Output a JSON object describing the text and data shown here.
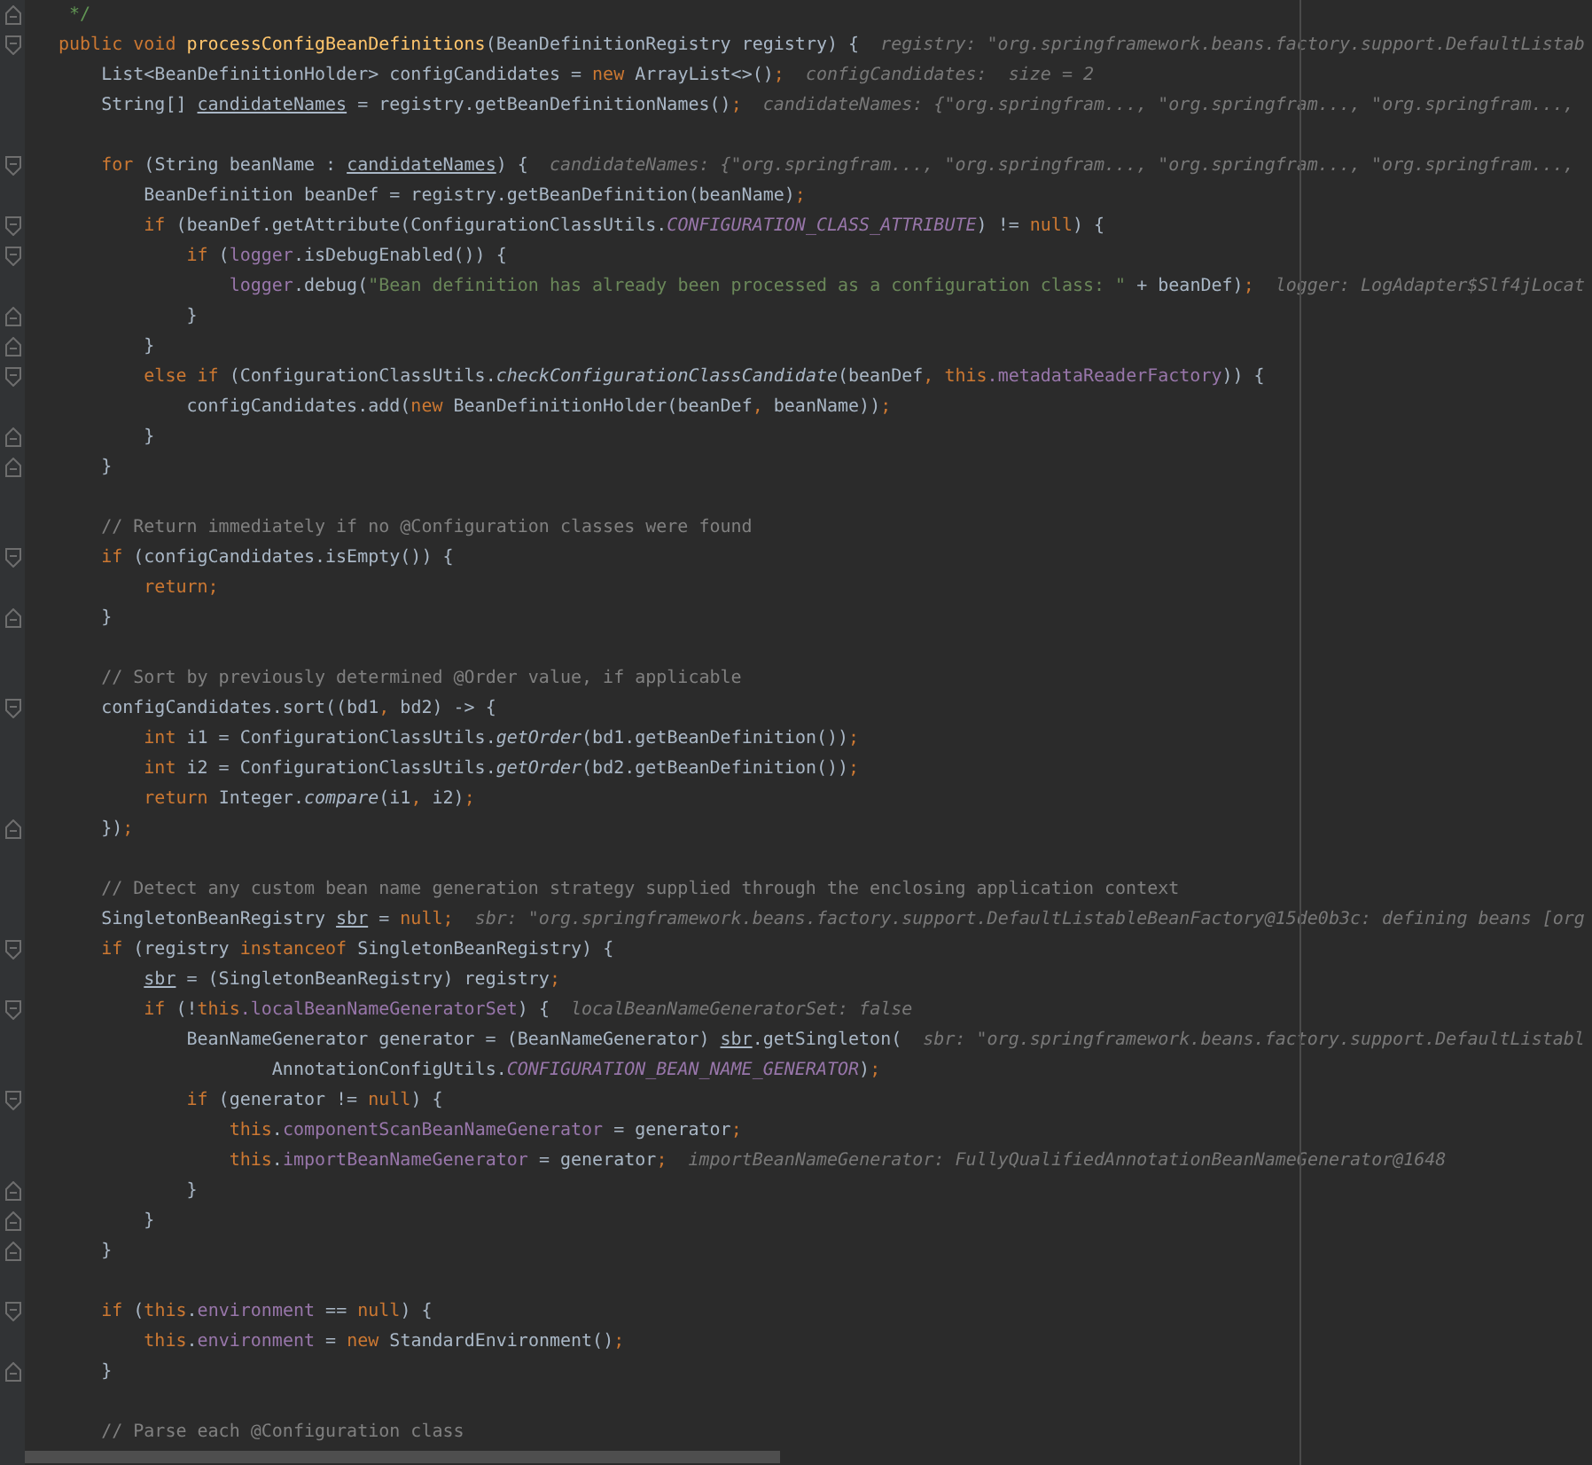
{
  "editor": {
    "lines": [
      {
        "kind": "doc-end",
        "fold_end": true,
        "tokens": [
          {
            "kind": "doc",
            "text": "*/"
          }
        ]
      },
      {
        "kind": "code",
        "fold_start": true,
        "tokens": [
          {
            "kind": "kw",
            "text": "public void "
          },
          {
            "kind": "decl",
            "text": "processConfigBeanDefinitions"
          },
          {
            "kind": "plain",
            "text": "(BeanDefinitionRegistry registry) {"
          }
        ],
        "hint": "registry: \"org.springframework.beans.factory.support.DefaultListab",
        "children": [
          {
            "kind": "code",
            "tokens": [
              {
                "kind": "plain",
                "text": "List<BeanDefinitionHolder> configCandidates = "
              },
              {
                "kind": "kw",
                "text": "new "
              },
              {
                "kind": "plain",
                "text": "ArrayList<>()"
              },
              {
                "kind": "punct",
                "text": ";"
              }
            ],
            "hint": "configCandidates:  size = 2"
          },
          {
            "kind": "code",
            "tokens": [
              {
                "kind": "plain",
                "text": "String[] "
              },
              {
                "kind": "under",
                "text": "candidateNames"
              },
              {
                "kind": "plain",
                "text": " = registry.getBeanDefinitionNames()"
              },
              {
                "kind": "punct",
                "text": ";"
              }
            ],
            "hint": "candidateNames: {\"org.springfram..., \"org.springfram..., \"org.springfram...,"
          },
          {
            "kind": "blank"
          },
          {
            "kind": "code",
            "fold_start": true,
            "tokens": [
              {
                "kind": "kw",
                "text": "for "
              },
              {
                "kind": "plain",
                "text": "(String beanName : "
              },
              {
                "kind": "under",
                "text": "candidateNames"
              },
              {
                "kind": "plain",
                "text": ") {"
              }
            ],
            "hint": "candidateNames: {\"org.springfram..., \"org.springfram..., \"org.springfram..., \"org.springfram...,",
            "children": [
              {
                "kind": "code",
                "tokens": [
                  {
                    "kind": "plain",
                    "text": "BeanDefinition beanDef = registry.getBeanDefinition(beanName)"
                  },
                  {
                    "kind": "punct",
                    "text": ";"
                  }
                ]
              },
              {
                "kind": "code",
                "fold_start": true,
                "tokens": [
                  {
                    "kind": "kw",
                    "text": "if "
                  },
                  {
                    "kind": "plain",
                    "text": "(beanDef.getAttribute(ConfigurationClassUtils."
                  },
                  {
                    "kind": "const",
                    "text": "CONFIGURATION_CLASS_ATTRIBUTE"
                  },
                  {
                    "kind": "plain",
                    "text": ") != "
                  },
                  {
                    "kind": "kw",
                    "text": "null"
                  },
                  {
                    "kind": "plain",
                    "text": ") {"
                  }
                ],
                "children": [
                  {
                    "kind": "code",
                    "fold_start": true,
                    "tokens": [
                      {
                        "kind": "kw",
                        "text": "if "
                      },
                      {
                        "kind": "plain",
                        "text": "("
                      },
                      {
                        "kind": "field",
                        "text": "logger"
                      },
                      {
                        "kind": "plain",
                        "text": ".isDebugEnabled()) {"
                      }
                    ],
                    "children": [
                      {
                        "kind": "code",
                        "tokens": [
                          {
                            "kind": "field",
                            "text": "logger"
                          },
                          {
                            "kind": "plain",
                            "text": ".debug("
                          },
                          {
                            "kind": "str",
                            "text": "\"Bean definition has already been processed as a configuration class: \""
                          },
                          {
                            "kind": "plain",
                            "text": " + beanDef)"
                          },
                          {
                            "kind": "punct",
                            "text": ";"
                          }
                        ],
                        "hint": "logger: LogAdapter$Slf4jLocat"
                      }
                    ]
                  },
                  {
                    "kind": "code",
                    "fold_end": true,
                    "tokens": [
                      {
                        "kind": "plain",
                        "text": "}"
                      }
                    ]
                  }
                ]
              },
              {
                "kind": "code",
                "fold_end": true,
                "tokens": [
                  {
                    "kind": "plain",
                    "text": "}"
                  }
                ]
              },
              {
                "kind": "code",
                "fold_start": true,
                "tokens": [
                  {
                    "kind": "kw",
                    "text": "else if "
                  },
                  {
                    "kind": "plain",
                    "text": "(ConfigurationClassUtils."
                  },
                  {
                    "kind": "italic",
                    "text": "checkConfigurationClassCandidate"
                  },
                  {
                    "kind": "plain",
                    "text": "(beanDef"
                  },
                  {
                    "kind": "kw",
                    "text": ", this"
                  },
                  {
                    "kind": "field",
                    "text": ".metadataReaderFactory"
                  },
                  {
                    "kind": "plain",
                    "text": ")) {"
                  }
                ],
                "children": [
                  {
                    "kind": "code",
                    "tokens": [
                      {
                        "kind": "plain",
                        "text": "configCandidates.add("
                      },
                      {
                        "kind": "kw",
                        "text": "new "
                      },
                      {
                        "kind": "plain",
                        "text": "BeanDefinitionHolder(beanDef"
                      },
                      {
                        "kind": "punct",
                        "text": ", "
                      },
                      {
                        "kind": "plain",
                        "text": "beanName))"
                      },
                      {
                        "kind": "punct",
                        "text": ";"
                      }
                    ]
                  }
                ]
              },
              {
                "kind": "code",
                "fold_end": true,
                "tokens": [
                  {
                    "kind": "plain",
                    "text": "}"
                  }
                ]
              }
            ]
          },
          {
            "kind": "code",
            "fold_end": true,
            "tokens": [
              {
                "kind": "plain",
                "text": "}"
              }
            ]
          },
          {
            "kind": "blank"
          },
          {
            "kind": "code",
            "tokens": [
              {
                "kind": "comment",
                "text": "// Return immediately if no @Configuration classes were found"
              }
            ]
          },
          {
            "kind": "code",
            "fold_start": true,
            "tokens": [
              {
                "kind": "kw",
                "text": "if "
              },
              {
                "kind": "plain",
                "text": "(configCandidates.isEmpty()) {"
              }
            ],
            "children": [
              {
                "kind": "code",
                "tokens": [
                  {
                    "kind": "kw",
                    "text": "return"
                  },
                  {
                    "kind": "punct",
                    "text": ";"
                  }
                ]
              }
            ]
          },
          {
            "kind": "code",
            "fold_end": true,
            "tokens": [
              {
                "kind": "plain",
                "text": "}"
              }
            ]
          },
          {
            "kind": "blank"
          },
          {
            "kind": "code",
            "tokens": [
              {
                "kind": "comment",
                "text": "// Sort by previously determined @Order value, if applicable"
              }
            ]
          },
          {
            "kind": "code",
            "fold_start": true,
            "tokens": [
              {
                "kind": "plain",
                "text": "configCandidates.sort((bd1"
              },
              {
                "kind": "punct",
                "text": ", "
              },
              {
                "kind": "plain",
                "text": "bd2) -> {"
              }
            ],
            "children": [
              {
                "kind": "code",
                "tokens": [
                  {
                    "kind": "kw",
                    "text": "int "
                  },
                  {
                    "kind": "plain",
                    "text": "i1 = ConfigurationClassUtils."
                  },
                  {
                    "kind": "italic",
                    "text": "getOrder"
                  },
                  {
                    "kind": "plain",
                    "text": "(bd1.getBeanDefinition())"
                  },
                  {
                    "kind": "punct",
                    "text": ";"
                  }
                ]
              },
              {
                "kind": "code",
                "tokens": [
                  {
                    "kind": "kw",
                    "text": "int "
                  },
                  {
                    "kind": "plain",
                    "text": "i2 = ConfigurationClassUtils."
                  },
                  {
                    "kind": "italic",
                    "text": "getOrder"
                  },
                  {
                    "kind": "plain",
                    "text": "(bd2.getBeanDefinition())"
                  },
                  {
                    "kind": "punct",
                    "text": ";"
                  }
                ]
              },
              {
                "kind": "code",
                "tokens": [
                  {
                    "kind": "kw",
                    "text": "return "
                  },
                  {
                    "kind": "plain",
                    "text": "Integer."
                  },
                  {
                    "kind": "italic",
                    "text": "compare"
                  },
                  {
                    "kind": "plain",
                    "text": "(i1"
                  },
                  {
                    "kind": "punct",
                    "text": ", "
                  },
                  {
                    "kind": "plain",
                    "text": "i2)"
                  },
                  {
                    "kind": "punct",
                    "text": ";"
                  }
                ]
              }
            ]
          },
          {
            "kind": "code",
            "fold_end": true,
            "tokens": [
              {
                "kind": "plain",
                "text": "})"
              },
              {
                "kind": "punct",
                "text": ";"
              }
            ]
          },
          {
            "kind": "blank"
          },
          {
            "kind": "code",
            "tokens": [
              {
                "kind": "comment",
                "text": "// Detect any custom bean name generation strategy supplied through the enclosing application context"
              }
            ]
          },
          {
            "kind": "code",
            "tokens": [
              {
                "kind": "plain",
                "text": "SingletonBeanRegistry "
              },
              {
                "kind": "under",
                "text": "sbr"
              },
              {
                "kind": "plain",
                "text": " = "
              },
              {
                "kind": "kw",
                "text": "null"
              },
              {
                "kind": "punct",
                "text": ";"
              }
            ],
            "hint": "sbr: \"org.springframework.beans.factory.support.DefaultListableBeanFactory@15de0b3c: defining beans [org"
          },
          {
            "kind": "code",
            "fold_start": true,
            "tokens": [
              {
                "kind": "kw",
                "text": "if "
              },
              {
                "kind": "plain",
                "text": "(registry "
              },
              {
                "kind": "kw",
                "text": "instanceof "
              },
              {
                "kind": "plain",
                "text": "SingletonBeanRegistry) {"
              }
            ],
            "children": [
              {
                "kind": "code",
                "tokens": [
                  {
                    "kind": "under",
                    "text": "sbr"
                  },
                  {
                    "kind": "plain",
                    "text": " = (SingletonBeanRegistry) registry"
                  },
                  {
                    "kind": "punct",
                    "text": ";"
                  }
                ]
              },
              {
                "kind": "code",
                "fold_start": true,
                "tokens": [
                  {
                    "kind": "kw",
                    "text": "if "
                  },
                  {
                    "kind": "plain",
                    "text": "(!"
                  },
                  {
                    "kind": "kw",
                    "text": "this"
                  },
                  {
                    "kind": "field",
                    "text": ".localBeanNameGeneratorSet"
                  },
                  {
                    "kind": "plain",
                    "text": ") {"
                  }
                ],
                "hint": "localBeanNameGeneratorSet: false",
                "children": [
                  {
                    "kind": "code",
                    "tokens": [
                      {
                        "kind": "plain",
                        "text": "BeanNameGenerator generator = (BeanNameGenerator) "
                      },
                      {
                        "kind": "under",
                        "text": "sbr"
                      },
                      {
                        "kind": "plain",
                        "text": ".getSingleton("
                      }
                    ],
                    "hint": "sbr: \"org.springframework.beans.factory.support.DefaultListabl"
                  },
                  {
                    "kind": "continuation",
                    "tokens": [
                      {
                        "kind": "plain",
                        "text": "AnnotationConfigUtils."
                      },
                      {
                        "kind": "const",
                        "text": "CONFIGURATION_BEAN_NAME_GENERATOR"
                      },
                      {
                        "kind": "plain",
                        "text": ")"
                      },
                      {
                        "kind": "punct",
                        "text": ";"
                      }
                    ]
                  },
                  {
                    "kind": "code",
                    "fold_start": true,
                    "tokens": [
                      {
                        "kind": "kw",
                        "text": "if "
                      },
                      {
                        "kind": "plain",
                        "text": "(generator != "
                      },
                      {
                        "kind": "kw",
                        "text": "null"
                      },
                      {
                        "kind": "plain",
                        "text": ") {"
                      }
                    ],
                    "children": [
                      {
                        "kind": "code",
                        "tokens": [
                          {
                            "kind": "kw",
                            "text": "this"
                          },
                          {
                            "kind": "plain",
                            "text": "."
                          },
                          {
                            "kind": "field",
                            "text": "componentScanBeanNameGenerator"
                          },
                          {
                            "kind": "plain",
                            "text": " = generator"
                          },
                          {
                            "kind": "punct",
                            "text": ";"
                          }
                        ]
                      },
                      {
                        "kind": "code",
                        "tokens": [
                          {
                            "kind": "kw",
                            "text": "this"
                          },
                          {
                            "kind": "plain",
                            "text": "."
                          },
                          {
                            "kind": "field",
                            "text": "importBeanNameGenerator"
                          },
                          {
                            "kind": "plain",
                            "text": " = generator"
                          },
                          {
                            "kind": "punct",
                            "text": ";"
                          }
                        ],
                        "hint": "importBeanNameGenerator: FullyQualifiedAnnotationBeanNameGenerator@1648"
                      }
                    ]
                  },
                  {
                    "kind": "code",
                    "fold_end": true,
                    "tokens": [
                      {
                        "kind": "plain",
                        "text": "}"
                      }
                    ]
                  }
                ]
              },
              {
                "kind": "code",
                "fold_end": true,
                "tokens": [
                  {
                    "kind": "plain",
                    "text": "}"
                  }
                ]
              }
            ]
          },
          {
            "kind": "code",
            "fold_end": true,
            "tokens": [
              {
                "kind": "plain",
                "text": "}"
              }
            ]
          },
          {
            "kind": "blank"
          },
          {
            "kind": "code",
            "fold_start": true,
            "tokens": [
              {
                "kind": "kw",
                "text": "if "
              },
              {
                "kind": "plain",
                "text": "("
              },
              {
                "kind": "kw",
                "text": "this"
              },
              {
                "kind": "plain",
                "text": "."
              },
              {
                "kind": "field",
                "text": "environment"
              },
              {
                "kind": "plain",
                "text": " == "
              },
              {
                "kind": "kw",
                "text": "null"
              },
              {
                "kind": "plain",
                "text": ") {"
              }
            ],
            "children": [
              {
                "kind": "code",
                "tokens": [
                  {
                    "kind": "kw",
                    "text": "this"
                  },
                  {
                    "kind": "plain",
                    "text": "."
                  },
                  {
                    "kind": "field",
                    "text": "environment"
                  },
                  {
                    "kind": "plain",
                    "text": " = "
                  },
                  {
                    "kind": "kw",
                    "text": "new "
                  },
                  {
                    "kind": "plain",
                    "text": "StandardEnvironment()"
                  },
                  {
                    "kind": "punct",
                    "text": ";"
                  }
                ]
              }
            ]
          },
          {
            "kind": "code",
            "fold_end": true,
            "tokens": [
              {
                "kind": "plain",
                "text": "}"
              }
            ]
          },
          {
            "kind": "blank"
          },
          {
            "kind": "code",
            "tokens": [
              {
                "kind": "comment",
                "text": "// Parse each @Configuration class"
              }
            ]
          }
        ]
      }
    ]
  }
}
